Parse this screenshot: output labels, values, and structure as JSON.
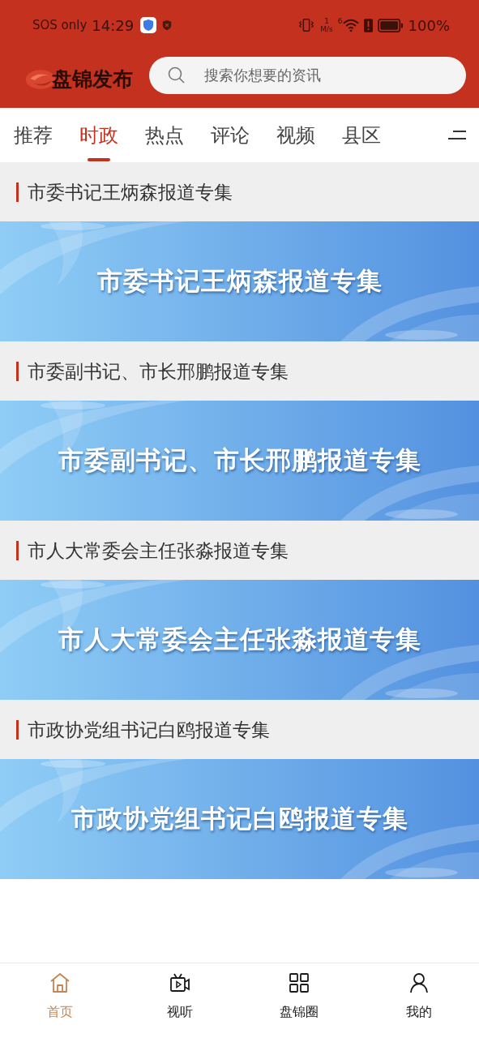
{
  "status_bar": {
    "carrier": "SOS only",
    "time": "14:29",
    "speed_value": "1",
    "speed_unit": "M/s",
    "signal_label": "6",
    "battery": "100%"
  },
  "header": {
    "logo_text": "盘锦发布",
    "search": {
      "placeholder": "搜索你想要的资讯"
    }
  },
  "tabs": [
    {
      "label": "推荐",
      "selected": false
    },
    {
      "label": "时政",
      "selected": true
    },
    {
      "label": "热点",
      "selected": false
    },
    {
      "label": "评论",
      "selected": false
    },
    {
      "label": "视频",
      "selected": false
    },
    {
      "label": "县区",
      "selected": false
    }
  ],
  "sections": [
    {
      "title": "市委书记王炳森报道专集",
      "banner": {
        "kind": "picture",
        "text": "市委书记王炳森报道专集"
      }
    },
    {
      "title": "市委副书记、市长邢鹏报道专集",
      "banner": {
        "kind": "picture",
        "text": "市委副书记、市长邢鹏报道专集"
      }
    },
    {
      "title": "市人大常委会主任张淼报道专集",
      "banner": {
        "kind": "picture",
        "text": "市人大常委会主任张淼报道专集"
      }
    },
    {
      "title": "市政协党组书记白鸥报道专集",
      "banner": {
        "kind": "picture",
        "text": "市政协党组书记白鸥报道专集"
      }
    }
  ],
  "bottom_nav": [
    {
      "label": "首页",
      "selected": true
    },
    {
      "label": "视听",
      "selected": false
    },
    {
      "label": "盘锦圈",
      "selected": false
    },
    {
      "label": "我的",
      "selected": false
    }
  ]
}
